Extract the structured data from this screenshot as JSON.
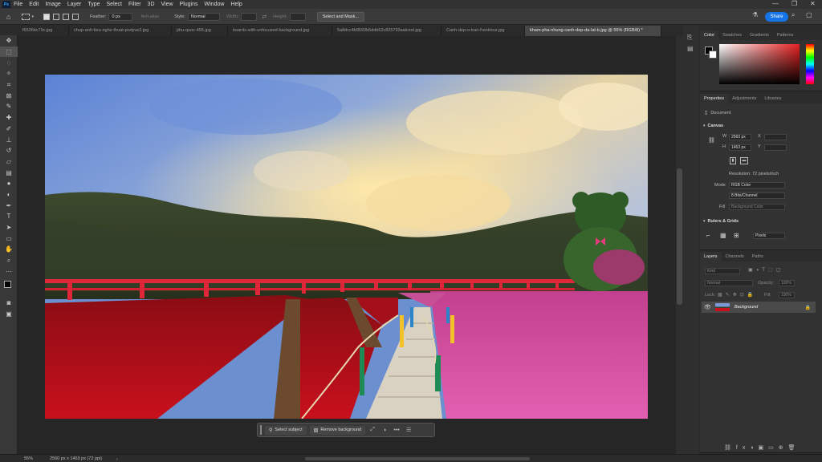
{
  "app": {
    "logo": "Ps"
  },
  "menu": [
    "File",
    "Edit",
    "Image",
    "Layer",
    "Type",
    "Select",
    "Filter",
    "3D",
    "View",
    "Plugins",
    "Window",
    "Help"
  ],
  "options": {
    "feather_label": "Feather:",
    "feather_value": "0 px",
    "antialias": "Anti-alias",
    "style_label": "Style:",
    "style_value": "Normal",
    "width_label": "Width:",
    "height_label": "Height:",
    "select_mask": "Select and Mask...",
    "share": "Share"
  },
  "tabs": [
    {
      "label": "f6536bc79c.jpg",
      "active": false
    },
    {
      "label": "chup-anh-tieu-nghe-thuat-podyve2.jpg",
      "active": false
    },
    {
      "label": "phu-quoc-455.jpg",
      "active": false
    },
    {
      "label": "boards-with-unfocused-background.jpg",
      "active": false
    },
    {
      "label": "5a8dcc4b9593b5ddb52c825793aalcest.jpg",
      "active": false
    },
    {
      "label": "Canh-dep-o-tran-franktour.jpg",
      "active": false
    },
    {
      "label": "kham-pha-nhung-canh-dep-da-lat-b.jpg @ 55% (RGB/8) *",
      "active": true
    }
  ],
  "tools": [
    "move-icon",
    "marquee-icon",
    "lasso-icon",
    "magic-wand-icon",
    "crop-icon",
    "frame-icon",
    "eyedropper-icon",
    "healing-icon",
    "brush-icon",
    "stamp-icon",
    "history-brush-icon",
    "eraser-icon",
    "gradient-icon",
    "blur-icon",
    "dodge-icon",
    "pen-icon",
    "type-icon",
    "path-select-icon",
    "shape-icon",
    "hand-icon",
    "zoom-icon",
    "more-icon"
  ],
  "context_bar": {
    "select_subject": "Select subject",
    "remove_background": "Remove background",
    "more": "•••"
  },
  "color_panel": {
    "tabs": [
      "Color",
      "Swatches",
      "Gradients",
      "Patterns"
    ],
    "fg": "#000000",
    "bg": "#ffffff"
  },
  "properties": {
    "tabs": [
      "Properties",
      "Adjustments",
      "Libraries"
    ],
    "doc_label": "Document",
    "canvas_header": "Canvas",
    "w_label": "W",
    "w_value": "2560 px",
    "h_label": "H",
    "h_value": "1463 px",
    "x_label": "X",
    "y_label": "Y",
    "resolution": "Resolution: 72 pixels/inch",
    "mode_label": "Mode",
    "mode_value": "RGB Color",
    "depth_value": "8 Bits/Channel",
    "fill_label": "Fill",
    "fill_value": "Background Color",
    "rulers_header": "Rulers & Grids",
    "units_value": "Pixels"
  },
  "layers": {
    "tabs": [
      "Layers",
      "Channels",
      "Paths"
    ],
    "kind": "Kind",
    "blend": "Normal",
    "opacity_label": "Opacity:",
    "opacity_value": "100%",
    "lock_label": "Lock:",
    "fill_label": "Fill:",
    "fill_value": "100%",
    "layer_name": "Background"
  },
  "status": {
    "zoom": "55%",
    "dims": "2560 px x 1463 px (72 ppi)"
  }
}
